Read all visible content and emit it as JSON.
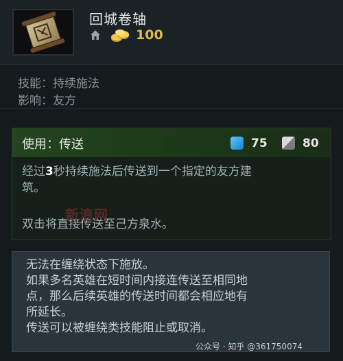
{
  "item": {
    "name": "回城卷轴",
    "cost": "100",
    "icons": {
      "shop": "home-icon",
      "gold": "gold-coins-icon",
      "item": "scroll-icon"
    }
  },
  "stats": [
    {
      "label": "技能：",
      "value": "持续施法"
    },
    {
      "label": "影响：",
      "value": "友方"
    }
  ],
  "ability": {
    "title": "使用：传送",
    "mana_cost": "75",
    "cooldown": "80",
    "desc_line1_pre": "经过",
    "desc_line1_num": "3",
    "desc_line1_post": "秒持续施法后传送到一个指定的友方建",
    "desc_line2": "筑。",
    "desc_line3": "双击将直接传送至己方泉水。"
  },
  "lore": [
    "无法在缠绕状态下施放。",
    "如果多名英雄在短时间内接连传送至相同地",
    "点，那么后续英雄的传送时间都会相应地有",
    "所延长。",
    "传送可以被缠绕类技能阻止或取消。"
  ],
  "watermarks": {
    "middle": "新浪网",
    "footer": "公众号 · 知乎 @361750074"
  },
  "colors": {
    "gold": "#e1b84b",
    "mana": "#3b9ee8",
    "ability_header": "#24451f",
    "lore_bg": "#29343c"
  }
}
